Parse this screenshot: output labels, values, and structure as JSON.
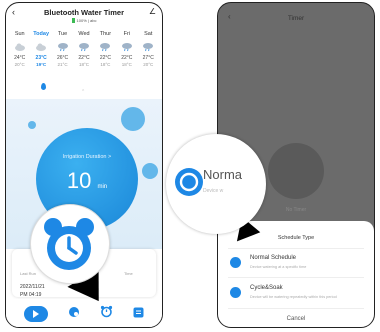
{
  "left": {
    "title": "Bluetooth Water Timer",
    "status": "100%  | abc",
    "days": [
      {
        "day": "Sun",
        "hi": "24°C",
        "lo": "20°C",
        "today": false,
        "icon": "cloud-icon"
      },
      {
        "day": "Today",
        "hi": "23°C",
        "lo": "19°C",
        "today": true,
        "icon": "cloud-icon"
      },
      {
        "day": "Tue",
        "hi": "26°C",
        "lo": "21°C",
        "today": false,
        "icon": "rain-cloud-icon"
      },
      {
        "day": "Wed",
        "hi": "22°C",
        "lo": "18°C",
        "today": false,
        "icon": "rain-cloud-icon"
      },
      {
        "day": "Thur",
        "hi": "22°C",
        "lo": "18°C",
        "today": false,
        "icon": "rain-cloud-icon"
      },
      {
        "day": "Fri",
        "hi": "22°C",
        "lo": "18°C",
        "today": false,
        "icon": "rain-cloud-icon"
      },
      {
        "day": "Sat",
        "hi": "27°C",
        "lo": "20°C",
        "today": false,
        "icon": "rain-cloud-icon"
      }
    ],
    "duration_label": "Irrigation Duration >",
    "duration_value": "10",
    "duration_unit": "min",
    "card_left_label": "Last Run",
    "card_date": "2022/11/21",
    "card_time": "PM 04:19",
    "card_right_label": "Time",
    "colors": {
      "accent": "#1e88e5"
    }
  },
  "right": {
    "title": "Timer",
    "no_timer": "No Timer",
    "sheet_title": "Schedule Type",
    "options": [
      {
        "title": "Normal Schedule",
        "desc": "Device watering  at a specific time",
        "icon": "clock-icon"
      },
      {
        "title": "Cycle&Soak",
        "desc": "Device will be watering repeatedly within this period",
        "icon": "hourglass-icon"
      }
    ],
    "cancel": "Cancel",
    "lens_title": "Norma",
    "lens_sub": "Device w"
  }
}
